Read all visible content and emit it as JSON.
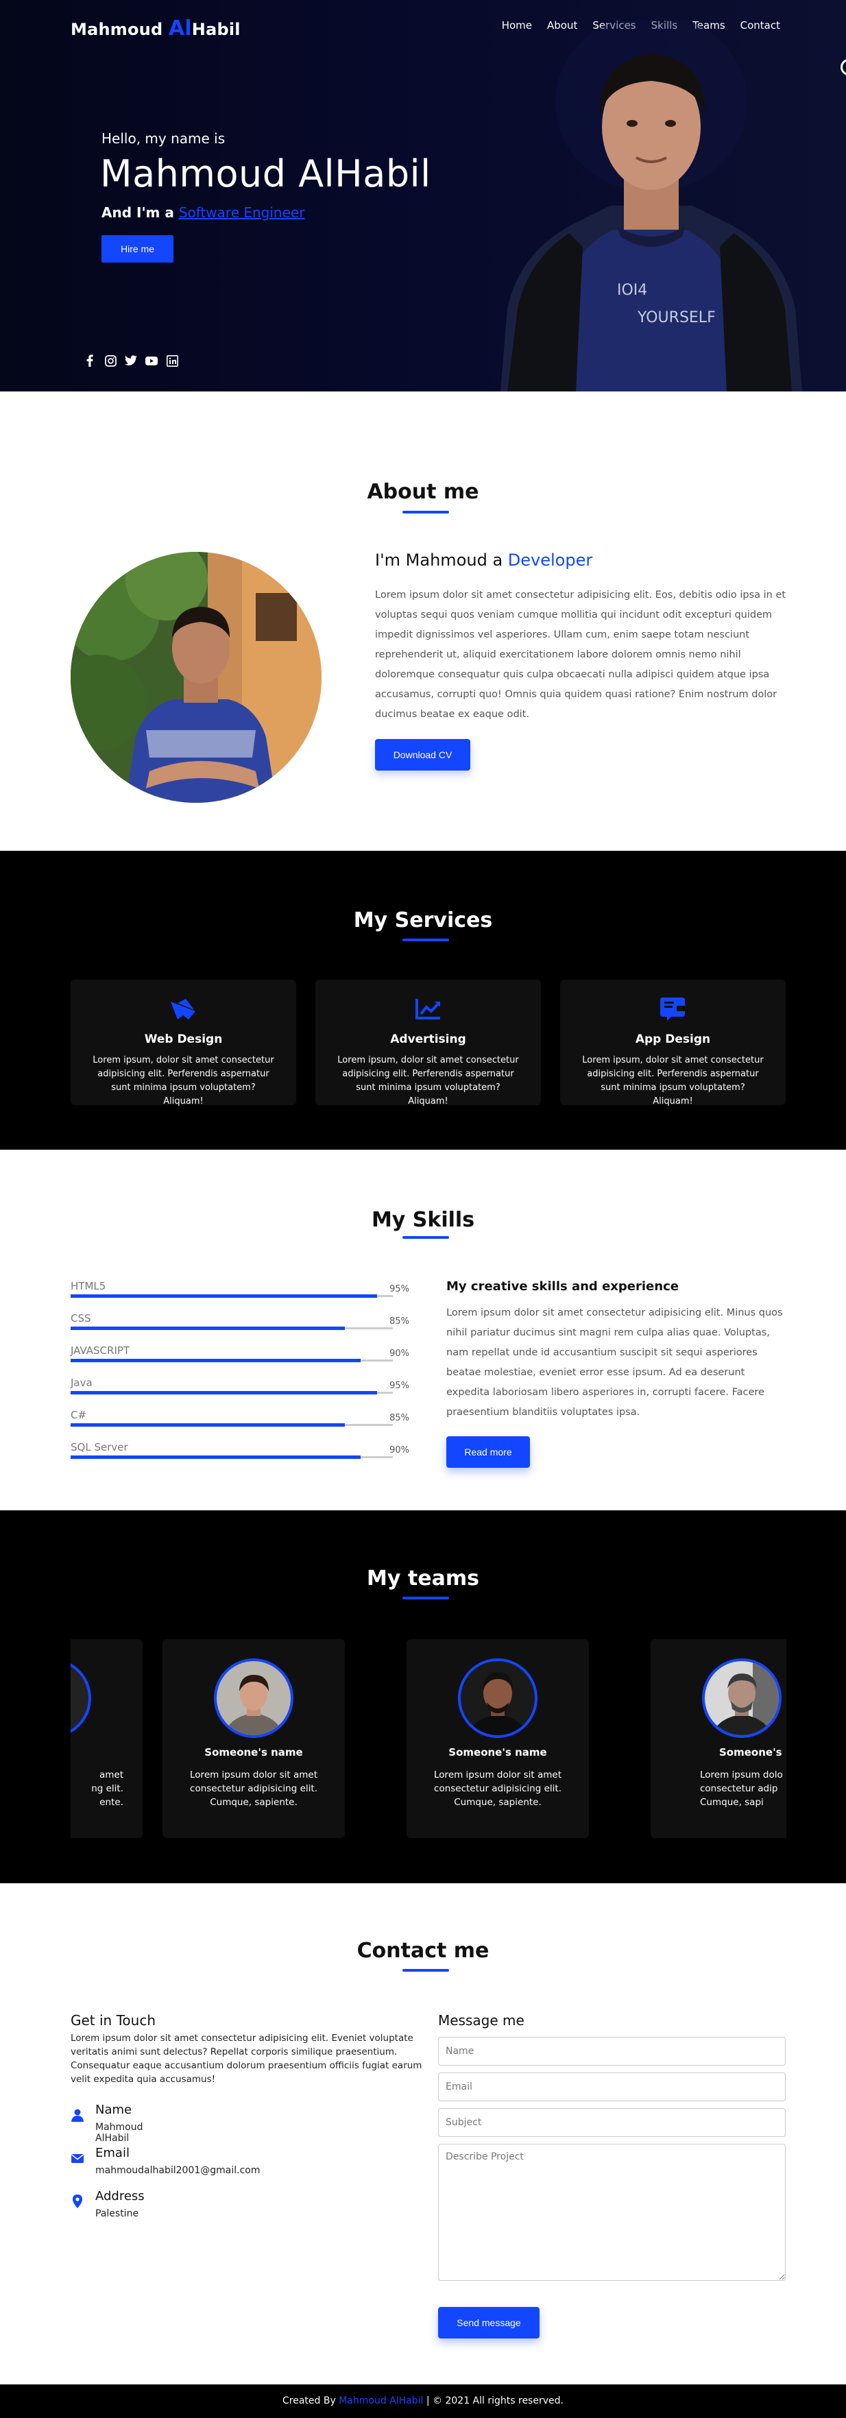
{
  "brand": {
    "prefix": "Mahmoud ",
    "accent": "Al",
    "suffix": "Habil"
  },
  "nav": [
    "Home",
    "About",
    "Services",
    "Skills",
    "Teams",
    "Contact"
  ],
  "hero": {
    "hello": "Hello, my name is",
    "name": "Mahmoud AlHabil",
    "role_prefix": "And I'm a ",
    "role": "Software Engineer",
    "hire_button": "Hire me",
    "social_icons": [
      "facebook-icon",
      "instagram-icon",
      "twitter-icon",
      "youtube-icon",
      "linkedin-icon"
    ]
  },
  "about": {
    "title": "About me",
    "heading_prefix": "I'm Mahmoud a ",
    "heading_accent": "Developer",
    "text": "Lorem ipsum dolor sit amet consectetur adipisicing elit. Eos, debitis odio ipsa in et voluptas sequi quos veniam cumque mollitia qui incidunt odit excepturi quidem impedit dignissimos vel asperiores. Ullam cum, enim saepe totam nesciunt reprehenderit ut, aliquid exercitationem labore dolorem omnis nemo nihil doloremque consequatur quis culpa obcaecati nulla adipisci quidem atque ipsa accusamus, corrupti quo! Omnis quia quidem quasi ratione? Enim nostrum dolor ducimus beatae ex eaque odit.",
    "button": "Download CV"
  },
  "services": {
    "title": "My Services",
    "items": [
      {
        "name": "Web Design",
        "icon": "paper-plane-icon",
        "desc": "Lorem ipsum, dolor sit amet consectetur adipisicing elit. Perferendis aspernatur sunt minima ipsum voluptatem? Aliquam!"
      },
      {
        "name": "Advertising",
        "icon": "chart-line-icon",
        "desc": "Lorem ipsum, dolor sit amet consectetur adipisicing elit. Perferendis aspernatur sunt minima ipsum voluptatem? Aliquam!"
      },
      {
        "name": "App Design",
        "icon": "app-design-icon",
        "desc": "Lorem ipsum, dolor sit amet consectetur adipisicing elit. Perferendis aspernatur sunt minima ipsum voluptatem? Aliquam!"
      }
    ]
  },
  "skills": {
    "title": "My Skills",
    "items": [
      {
        "label": "HTML5",
        "pct": "95%",
        "value": 0.95
      },
      {
        "label": "CSS",
        "pct": "85%",
        "value": 0.85
      },
      {
        "label": "JAVASCRIPT",
        "pct": "90%",
        "value": 0.9
      },
      {
        "label": "Java",
        "pct": "95%",
        "value": 0.95
      },
      {
        "label": "C#",
        "pct": "85%",
        "value": 0.85
      },
      {
        "label": "SQL Server",
        "pct": "90%",
        "value": 0.9
      }
    ],
    "heading": "My creative skills and experience",
    "text": "Lorem ipsum dolor sit amet consectetur adipisicing elit. Minus quos nihil pariatur ducimus sint magni rem culpa alias quae. Voluptas, nam repellat unde id accusantium suscipit sit sequi asperiores beatae molestiae, eveniet error esse ipsum. Ad ea deserunt expedita laboriosam libero asperiores in, corrupti facere. Facere praesentium blanditiis voluptates ipsa.",
    "button": "Read more"
  },
  "teams": {
    "title": "My teams",
    "partial_left": {
      "name": "e",
      "desc": "amet\nng elit.\nente."
    },
    "members": [
      {
        "name": "Someone's name",
        "desc": "Lorem ipsum dolor sit amet consectetur adipisicing elit. Cumque, sapiente."
      },
      {
        "name": "Someone's name",
        "desc": "Lorem ipsum dolor sit amet consectetur adipisicing elit. Cumque, sapiente."
      }
    ],
    "partial_right": {
      "name": "Someone's n",
      "desc": "Lorem ipsum dolo\nconsectetur adip\nCumque, sapi"
    }
  },
  "contact": {
    "title": "Contact me",
    "get_in_touch": "Get in Touch",
    "intro": "Lorem ipsum dolor sit amet consectetur adipisicing elit. Eveniet voluptate veritatis animi sunt delectus? Repellat corporis similique praesentium. Consequatur eaque accusantium dolorum praesentium officiis fugiat earum velit expedita quia accusamus!",
    "info": [
      {
        "key": "Name",
        "value": "Mahmoud AlHabil",
        "icon": "user-icon"
      },
      {
        "key": "Email",
        "value": "mahmoudalhabil2001@gmail.com",
        "icon": "envelope-icon"
      },
      {
        "key": "Address",
        "value": "Palestine",
        "icon": "location-pin-icon"
      }
    ],
    "form_title": "Message me",
    "placeholders": {
      "name": "Name",
      "email": "Email",
      "subject": "Subject",
      "project": "Describe Project"
    },
    "send_button": "Send message"
  },
  "footer": {
    "prefix": "Created By ",
    "accent": "Mahmoud AlHabil",
    "suffix": " | © 2021 All rights reserved."
  },
  "colors": {
    "accent": "#1346ff",
    "dark": "#000000",
    "card": "#101010"
  }
}
